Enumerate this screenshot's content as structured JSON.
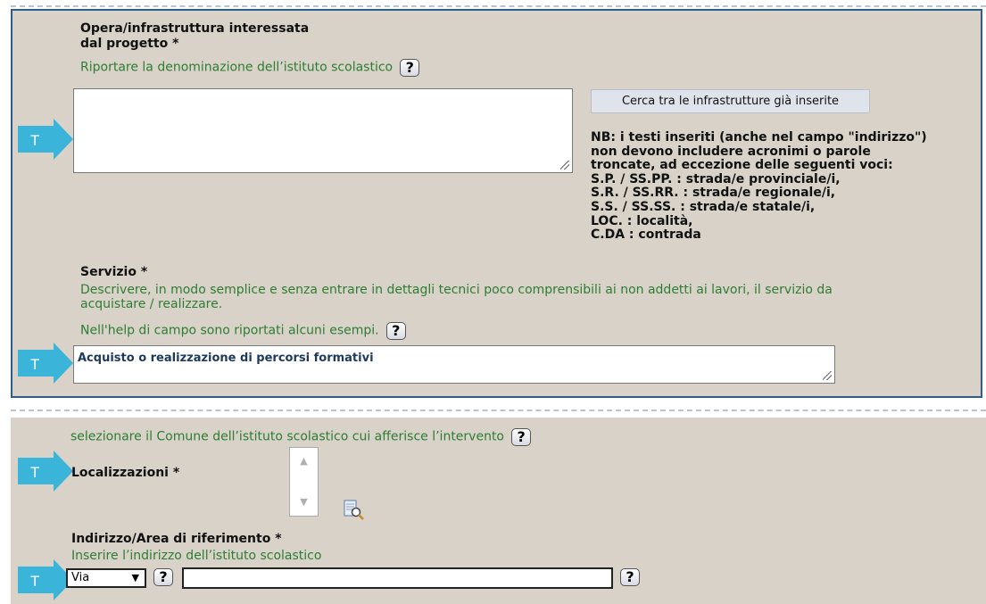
{
  "badge_letter": "T",
  "section_opera": {
    "label_line1": "Opera/infrastruttura interessata",
    "label_line2": "dal progetto *",
    "hint": "Riportare la denominazione dell’istituto scolastico",
    "help_label": "?",
    "textarea_value": "",
    "search_button_label": "Cerca tra le infrastrutture già inserite",
    "nb_lines": [
      "NB: i testi inseriti (anche nel campo \"indirizzo\")",
      "non devono includere acronimi o parole",
      "troncate, ad eccezione delle seguenti voci:",
      "S.P. / SS.PP. : strada/e provinciale/i,",
      "S.R. / SS.RR. : strada/e regionale/i,",
      "S.S. / SS.SS. : strada/e statale/i,",
      "LOC. : località,",
      "C.DA : contrada"
    ]
  },
  "section_servizio": {
    "label": "Servizio *",
    "hint_line1": "Descrivere, in modo semplice e senza entrare in dettagli tecnici poco comprensibili ai non addetti ai lavori, il servizio da",
    "hint_line2": "acquistare / realizzare.",
    "hint_line3": "Nell'help di campo sono riportati alcuni esempi.",
    "help_label": "?",
    "textarea_value": "Acquisto o realizzazione di percorsi formativi"
  },
  "section_localizzazione": {
    "hint": "selezionare il Comune dell’istituto scolastico cui afferisce l’intervento",
    "help_label": "?",
    "label": "Localizzazioni *",
    "up_arrow": "▲",
    "down_arrow": "▼"
  },
  "section_indirizzo": {
    "label": "Indirizzo/Area di riferimento *",
    "hint": "Inserire l’indirizzo dell’istituto scolastico",
    "select_value": "Via",
    "select_chevron": "▼",
    "help_label": "?",
    "address_value": ""
  },
  "colors": {
    "panel_bg": "#d8d2c9",
    "panel_border": "#2d5d88",
    "hint_green": "#2e7d32",
    "badge_cyan": "#3ab4d8"
  }
}
